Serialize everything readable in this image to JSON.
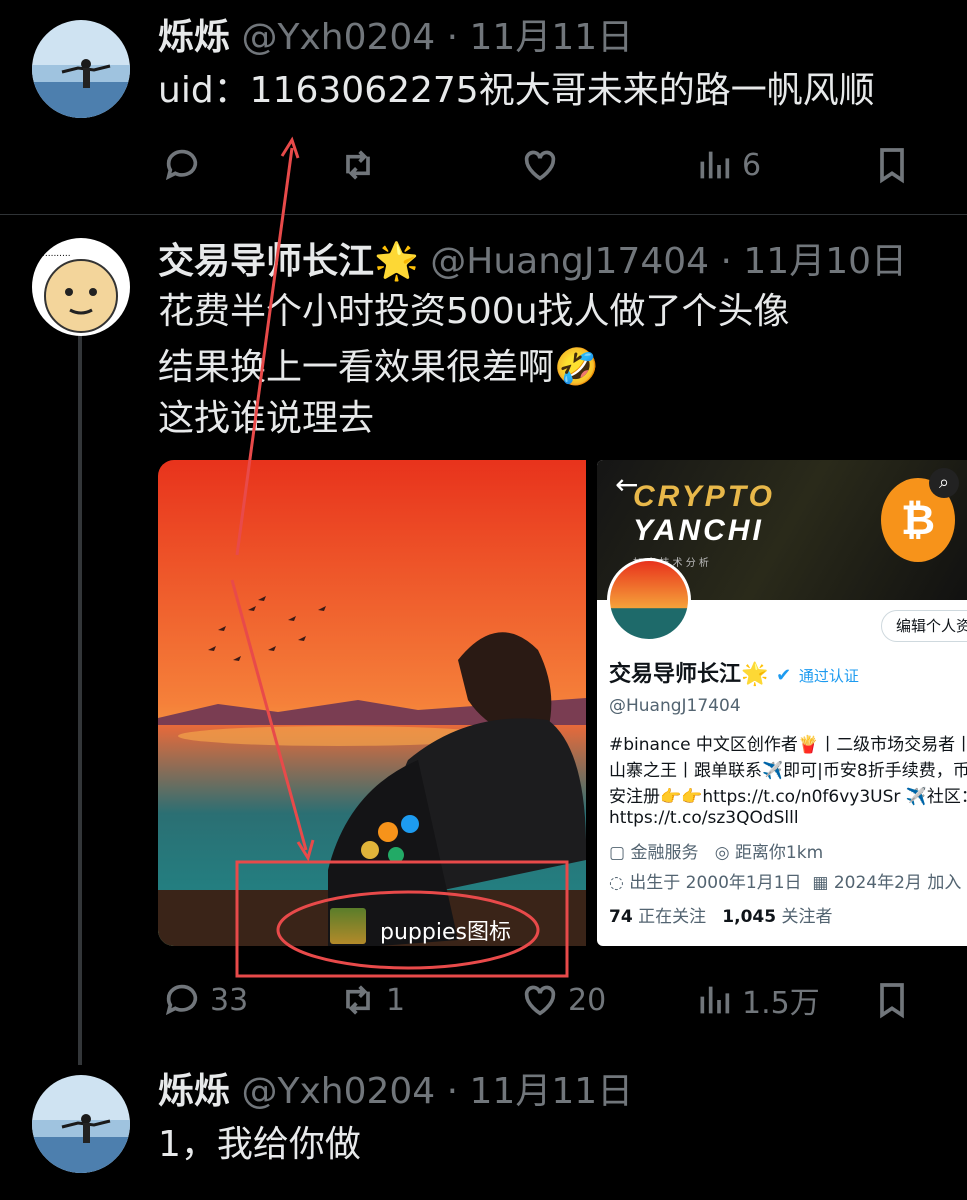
{
  "tweets": [
    {
      "name": "烁烁",
      "meta": "@Yxh0204 · 11月11日",
      "text": "uid：1163062275祝大哥未来的路一帆风顺",
      "actions": {
        "reply": "",
        "retweet": "",
        "like": "",
        "views": "6"
      }
    },
    {
      "name": "交易导师长江",
      "emoji": "🌟",
      "meta": "@HuangJ17404 · 11月10日",
      "lines": [
        "花费半个小时投资500u找人做了个头像",
        "结果换上一看效果很差啊🤣",
        "这找谁说理去"
      ],
      "actions": {
        "reply": "33",
        "retweet": "1",
        "like": "20",
        "views": "1.5万"
      },
      "annotation_label": "puppies图标"
    },
    {
      "name": "烁烁",
      "meta": "@Yxh0204 · 11月11日",
      "text": "1，我给你做"
    }
  ],
  "profile_card": {
    "banner_title_1": "CRYPTO",
    "banner_title_2": "YANCHI",
    "banner_subtitle": "加 密 技 术 分 析",
    "edit_button": "编辑个人资",
    "name": "交易导师长江🌟",
    "verified": "通过认证",
    "handle": "@HuangJ17404",
    "bio_1": "#binance 中文区创作者🍟丨二级市场交易者丨",
    "bio_2": "山寨之王丨跟单联系✈️即可|币安8折手续费，币",
    "bio_3": "安注册👉👉https://t.co/n0f6vy3USr ✈️社区：",
    "bio_4": "https://t.co/sz3QOdSlll",
    "category": "金融服务",
    "location": "距离你1km",
    "birthday": "出生于 2000年1月1日",
    "joined": "2024年2月 加入",
    "following_count": "74",
    "following_label": "正在关注",
    "followers_count": "1,045",
    "followers_label": "关注者"
  },
  "colors": {
    "background": "#000000",
    "muted": "#71767b",
    "annotation": "#e84a4a",
    "verified": "#1d9bf0"
  }
}
